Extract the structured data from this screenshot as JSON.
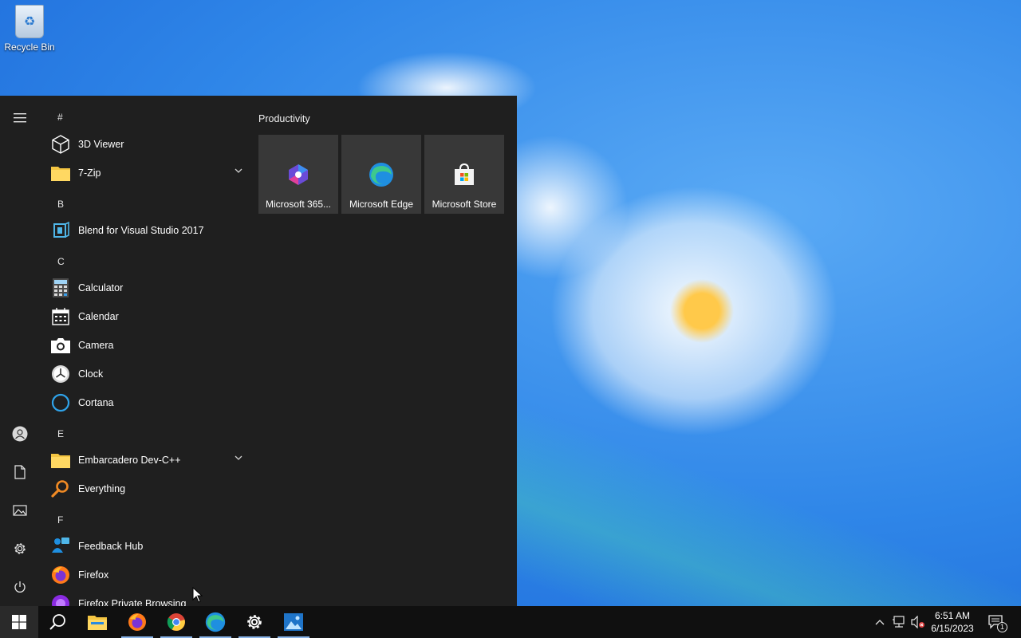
{
  "desktop": {
    "icons": [
      {
        "label": "Recycle Bin"
      }
    ]
  },
  "start_menu": {
    "groups": [
      {
        "letter": "#",
        "apps": [
          {
            "name": "3D Viewer"
          },
          {
            "name": "7-Zip"
          }
        ]
      },
      {
        "letter": "B",
        "apps": [
          {
            "name": "Blend for Visual Studio 2017"
          }
        ]
      },
      {
        "letter": "C",
        "apps": [
          {
            "name": "Calculator"
          },
          {
            "name": "Calendar"
          },
          {
            "name": "Camera"
          },
          {
            "name": "Clock"
          },
          {
            "name": "Cortana"
          }
        ]
      },
      {
        "letter": "E",
        "apps": [
          {
            "name": "Embarcadero Dev-C++"
          },
          {
            "name": "Everything"
          }
        ]
      },
      {
        "letter": "F",
        "apps": [
          {
            "name": "Feedback Hub"
          },
          {
            "name": "Firefox"
          },
          {
            "name": "Firefox Private Browsing"
          }
        ]
      }
    ],
    "tiles_section": {
      "title": "Productivity",
      "tiles": [
        {
          "label": "Microsoft 365...",
          "icon": "microsoft-365-icon"
        },
        {
          "label": "Microsoft Edge",
          "icon": "edge-icon"
        },
        {
          "label": "Microsoft Store",
          "icon": "store-icon"
        }
      ]
    }
  },
  "taskbar": {
    "clock": {
      "time": "6:51 AM",
      "date": "6/15/2023"
    },
    "notification_count": "1"
  },
  "colors": {
    "menu_bg": "#1f1f1f",
    "tile_bg": "#383838",
    "taskbar_bg": "#101010",
    "folder": "#f4c542",
    "edge_blue": "#1f8fe0",
    "accent": "#8ab4e8"
  }
}
